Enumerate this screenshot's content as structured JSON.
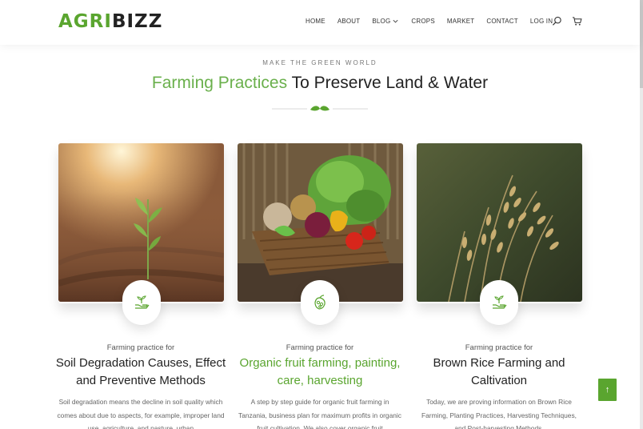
{
  "brand": {
    "part1": "AGRI",
    "part2": "BIZZ"
  },
  "nav": {
    "items": [
      {
        "label": "HOME"
      },
      {
        "label": "ABOUT"
      },
      {
        "label": "BLOG",
        "dropdown": true
      },
      {
        "label": "CROPS"
      },
      {
        "label": "MARKET"
      },
      {
        "label": "CONTACT"
      },
      {
        "label": "LOG IN"
      }
    ],
    "icons": [
      "search-icon",
      "cart-icon"
    ]
  },
  "section": {
    "kicker": "MAKE THE GREEN WORLD",
    "title_green": "Farming Practices",
    "title_rest": " To Preserve Land & Water"
  },
  "cards": [
    {
      "icon": "plant-in-hand-icon",
      "kicker": "Farming practice for",
      "title": "Soil Degradation Causes, Effect and Preventive Methods",
      "title_color": "dark",
      "excerpt": "Soil degradation means the decline in soil quality which comes about due to aspects, for example, improper land use, agriculture, and pasture, urban"
    },
    {
      "icon": "fruit-icon",
      "kicker": "Farming practice for",
      "title": "Organic fruit farming, painting, care, harvesting",
      "title_color": "green",
      "excerpt": "A step by step guide for organic fruit farming in Tanzania, business plan for maximum profits in organic fruit cultivation. We also cover organic fruit"
    },
    {
      "icon": "plant-in-hand-icon",
      "kicker": "Farming practice for",
      "title": "Brown Rice Farming and Caltivation",
      "title_color": "dark",
      "excerpt": "Today, we are proving information on Brown Rice Farming, Planting Practices, Harvesting Techniques, and Post-harvesting Methods."
    }
  ],
  "back_to_top": {
    "label": "↑"
  },
  "colors": {
    "accent": "#5aa52f",
    "accent_light": "#6ab04c",
    "text": "#222222"
  }
}
